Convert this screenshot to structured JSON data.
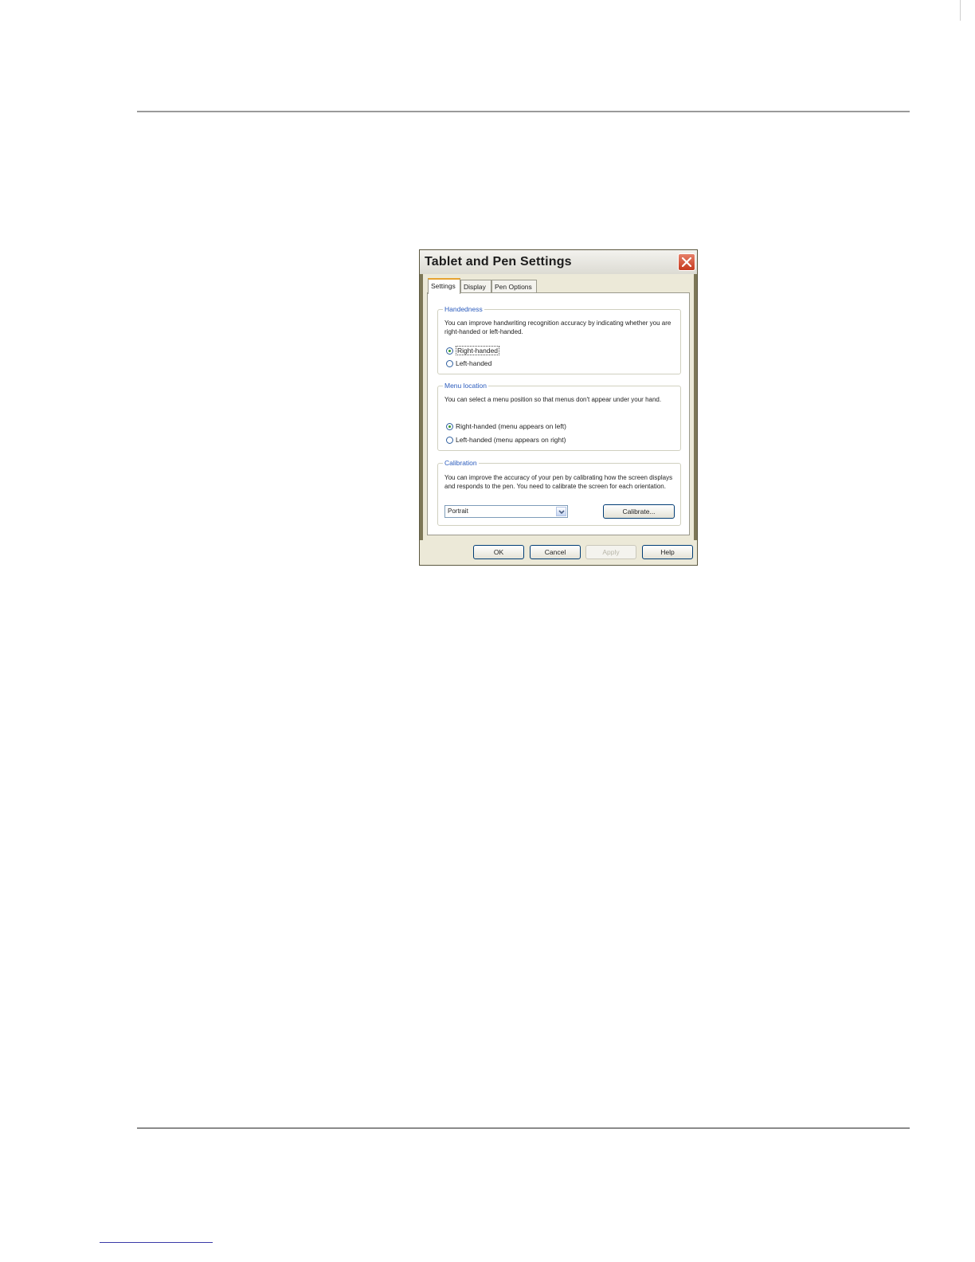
{
  "window": {
    "title": "Tablet and Pen Settings"
  },
  "tabs": [
    {
      "label": "Settings",
      "active": true
    },
    {
      "label": "Display",
      "active": false
    },
    {
      "label": "Pen Options",
      "active": false
    }
  ],
  "handedness": {
    "legend": "Handedness",
    "description": "You can improve handwriting recognition accuracy by indicating whether you are right-handed or left-handed.",
    "options": [
      {
        "label": "Right-handed",
        "checked": true
      },
      {
        "label": "Left-handed",
        "checked": false
      }
    ]
  },
  "menu_location": {
    "legend": "Menu location",
    "description": "You can select a menu position so that menus don't appear under your hand.",
    "options": [
      {
        "label": "Right-handed (menu appears on left)",
        "checked": true
      },
      {
        "label": "Left-handed (menu appears on right)",
        "checked": false
      }
    ]
  },
  "calibration": {
    "legend": "Calibration",
    "description": "You can improve the accuracy of your pen by calibrating how the screen displays and responds to the pen. You need to calibrate the screen for each orientation.",
    "orientation_value": "Portrait",
    "calibrate_label": "Calibrate..."
  },
  "buttons": {
    "ok": "OK",
    "cancel": "Cancel",
    "apply": "Apply",
    "help": "Help"
  }
}
